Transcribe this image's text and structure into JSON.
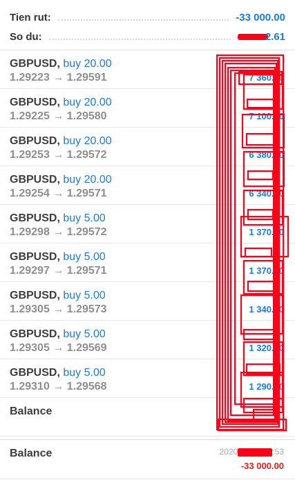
{
  "summary": {
    "withdraw_label": "Tien rut:",
    "withdraw_value": "-33 000.00",
    "balance_label": "So du:",
    "balance_value_suffix": "2.61"
  },
  "trades": [
    {
      "symbol": "GBPUSD,",
      "side": "buy 20.00",
      "prices": "1.29223 → 1.29591",
      "time": "",
      "profit": "7 360.00"
    },
    {
      "symbol": "GBPUSD,",
      "side": "buy 20.00",
      "prices": "1.29225 → 1.29580",
      "time": "",
      "profit": "7 100.00"
    },
    {
      "symbol": "GBPUSD,",
      "side": "buy 20.00",
      "prices": "1.29253 → 1.29572",
      "time": "",
      "profit": "6 380.00"
    },
    {
      "symbol": "GBPUSD,",
      "side": "buy 20.00",
      "prices": "1.29254 → 1.29571",
      "time": "",
      "profit": "6 340.00"
    },
    {
      "symbol": "GBPUSD,",
      "side": "buy 5.00",
      "prices": "1.29298 → 1.29572",
      "time": "",
      "profit": "1 370.00"
    },
    {
      "symbol": "GBPUSD,",
      "side": "buy 5.00",
      "prices": "1.29297 → 1.29571",
      "time": "",
      "profit": "1 370.00"
    },
    {
      "symbol": "GBPUSD,",
      "side": "buy 5.00",
      "prices": "1.29305 → 1.29573",
      "time": "",
      "profit": "1 340.00"
    },
    {
      "symbol": "GBPUSD,",
      "side": "buy 5.00",
      "prices": "1.29305 → 1.29569",
      "time": "",
      "profit": "1 320.00"
    },
    {
      "symbol": "GBPUSD,",
      "side": "buy 5.00",
      "prices": "1.29310 → 1.29568",
      "time": "",
      "profit": "1 290.00"
    }
  ],
  "balance_row_1": {
    "label": "Balance",
    "time": "",
    "amount": ""
  },
  "balance_row_2": {
    "label": "Balance",
    "time_prefix": "2020",
    "time_suffix": ":53",
    "amount": "-33 000.00"
  },
  "colors": {
    "accent": "#1a7bd9",
    "negative": "#e02020",
    "redaction": "#ff0018"
  }
}
